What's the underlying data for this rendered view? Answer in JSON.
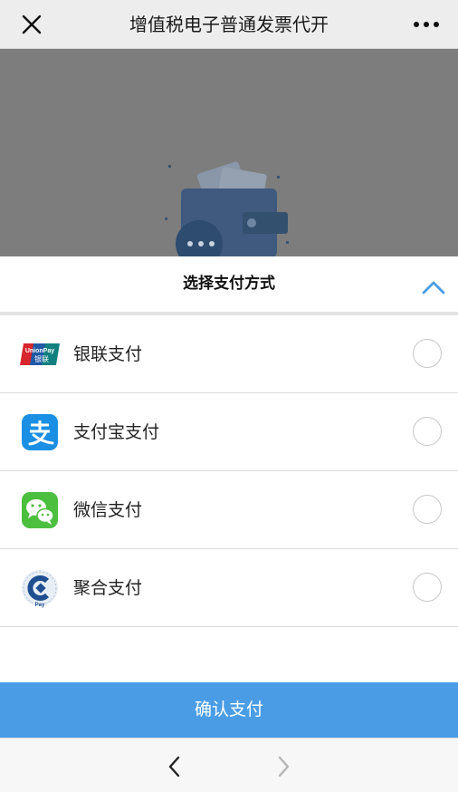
{
  "header": {
    "title": "增值税电子普通发票代开",
    "close_icon": "close-icon",
    "more_icon": "more-icon"
  },
  "payment_sheet": {
    "title": "选择支付方式",
    "collapse_icon": "chevron-up-icon",
    "options": [
      {
        "label": "银联支付",
        "icon": "unionpay-icon",
        "selected": false
      },
      {
        "label": "支付宝支付",
        "icon": "alipay-icon",
        "selected": false
      },
      {
        "label": "微信支付",
        "icon": "wechat-pay-icon",
        "selected": false
      },
      {
        "label": "聚合支付",
        "icon": "aggregate-pay-icon",
        "selected": false
      }
    ],
    "confirm_label": "确认支付"
  },
  "unionpay_logo_text": [
    "UnionPay",
    "银联"
  ],
  "aggregate_logo_text": "Pay",
  "navigation": {
    "back_icon": "chevron-left-icon",
    "forward_icon": "chevron-right-icon",
    "forward_enabled": false
  },
  "colors": {
    "accent": "#4a9de5",
    "backdrop": "#7d7d7d",
    "alipay": "#1a8fe3",
    "wechat": "#4cbf3f",
    "unionpay_red": "#d7262e",
    "unionpay_blue": "#1f5aa5",
    "unionpay_green": "#11807f"
  }
}
